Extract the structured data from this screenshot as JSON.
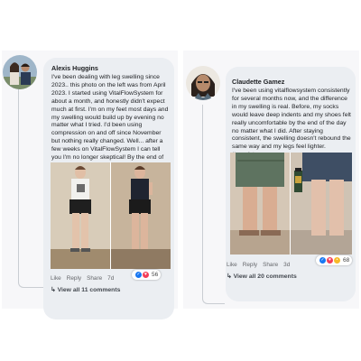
{
  "left_comment": {
    "author": "Alexis Huggins",
    "text": "I've been dealing with leg swelling since 2023.. this photo on the left was from April 2023. I started using VitalFlowSystem for about a month, and honestly didn't expect much at first. I'm on my feet most days and my swelling would build up by evening no matter what I tried. I'd been using compression on and off since November but nothing really changed. Well... after a few weeks on VitalFlowSystem I can tell you I'm no longer skeptical! By the end of the day my legs look less swollen, feel lighter, and the difference is noticeable.",
    "actions": {
      "like": "Like",
      "reply": "Reply",
      "share": "Share",
      "time": "7d"
    },
    "reaction_count": "56",
    "view_all": "View all 11 comments"
  },
  "right_comment": {
    "author": "Claudette Gamez",
    "text": "I've been using vitalflowsystem consistently for several months now, and the difference in my swelling is real. Before, my socks would leave deep indents and my shoes felt really uncomfortable by the end of the day no matter what I did. After staying consistent, the swelling doesn't rebound the same way and my legs feel lighter. #consistency",
    "actions": {
      "like": "Like",
      "reply": "Reply",
      "share": "Share",
      "time": "3d"
    },
    "reaction_count": "68",
    "view_all": "View all 20 comments"
  },
  "colors": {
    "bubble": "#ebeef2",
    "like_blue": "#1877f2",
    "love_red": "#f33e58",
    "haha_yellow": "#f7b928"
  }
}
